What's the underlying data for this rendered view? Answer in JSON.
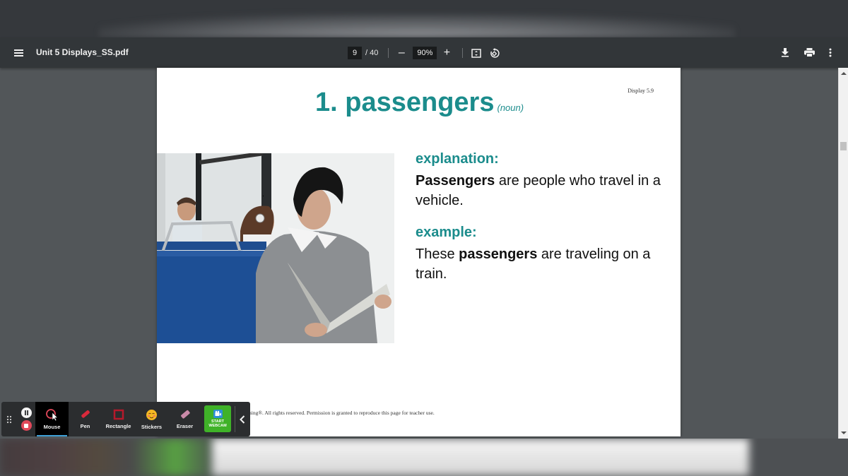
{
  "viewer": {
    "doc_title": "Unit 5 Displays_SS.pdf",
    "page_current": "9",
    "page_total": "/ 40",
    "zoom_level": "90%",
    "zoom_out_symbol": "–",
    "zoom_in_symbol": "+",
    "icons": {
      "menu": "menu-icon",
      "fit_page": "fit-page-icon",
      "rotate": "rotate-icon",
      "download": "download-icon",
      "print": "print-icon",
      "more": "more-vert-icon"
    }
  },
  "page": {
    "display_number": "Display 5.9",
    "word_title": "1. passengers",
    "part_of_speech": "(noun)",
    "explanation_label": "explanation:",
    "explanation_bold": "Passengers",
    "explanation_rest": " are people who travel in a vehicle.",
    "example_label": "example:",
    "example_pre": "These ",
    "example_bold": "passengers",
    "example_post": " are traveling on a train.",
    "image_alt": "Woman reading a folder while seated on a train, other passengers behind her",
    "footer": "hing®. All rights reserved. Permission is granted to reproduce this page for teacher use."
  },
  "recorder": {
    "tools": [
      {
        "label": "Mouse",
        "icon": "mouse-cursor-icon",
        "active": true
      },
      {
        "label": "Pen",
        "icon": "pen-icon",
        "active": false
      },
      {
        "label": "Rectangle",
        "icon": "rectangle-icon",
        "active": false
      },
      {
        "label": "Stickers",
        "icon": "sticker-icon",
        "active": false
      },
      {
        "label": "Eraser",
        "icon": "eraser-icon",
        "active": false
      }
    ],
    "webcam_line1": "START",
    "webcam_line2": "WEBCAM",
    "colors": {
      "accent": "#3ea0d6",
      "webcam_green": "#3fb228",
      "record_red": "#e0485a"
    }
  },
  "colors": {
    "title_teal": "#1b8c8c",
    "toolbar_bg": "#323639",
    "viewer_bg": "#525659"
  }
}
